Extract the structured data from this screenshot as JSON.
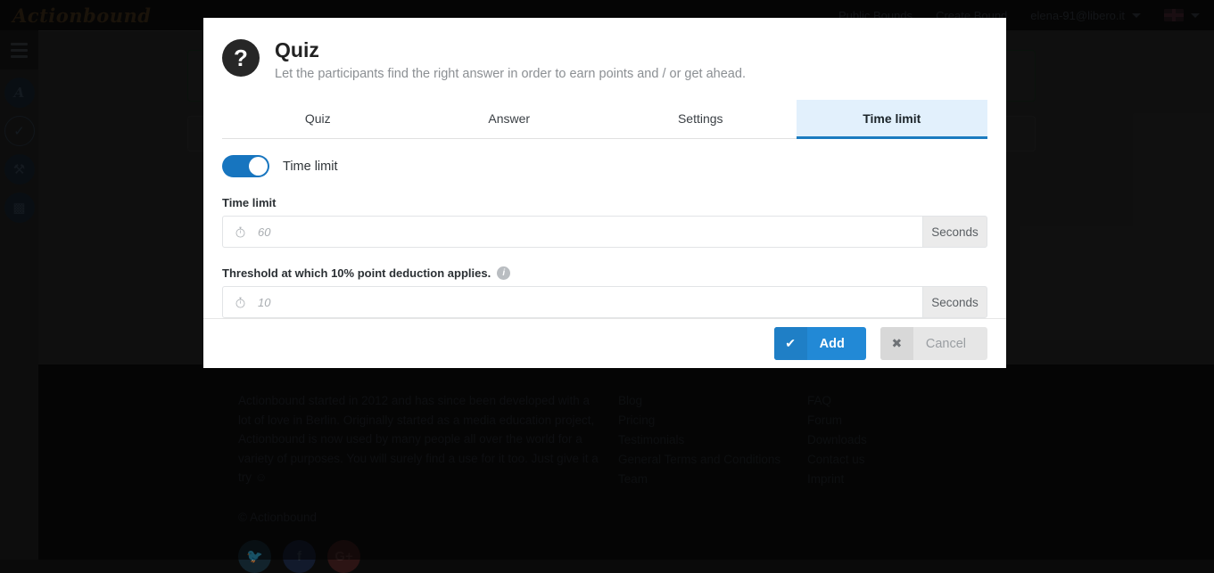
{
  "navbar": {
    "brand": "Actionbound",
    "links": [
      "Public Bounds",
      "Create Bound"
    ],
    "user": "elena-91@libero.it",
    "language_flag": "uk-flag-icon"
  },
  "sidebar": {
    "menu_icon": "hamburger-icon",
    "items": [
      {
        "icon": "actionbound-a-icon"
      },
      {
        "icon": "feather-quill-icon"
      },
      {
        "icon": "wrench-icon"
      },
      {
        "icon": "bar-chart-icon"
      }
    ]
  },
  "modal": {
    "icon": "question-mark-icon",
    "title": "Quiz",
    "subtitle": "Let the participants find the right answer in order to earn points and / or get ahead.",
    "tabs": [
      {
        "label": "Quiz",
        "active": false
      },
      {
        "label": "Answer",
        "active": false
      },
      {
        "label": "Settings",
        "active": false
      },
      {
        "label": "Time limit",
        "active": true
      }
    ],
    "toggle": {
      "label": "Time limit",
      "on": true
    },
    "fields": [
      {
        "label": "Time limit",
        "placeholder": "60",
        "unit": "Seconds",
        "icon": "stopwatch-icon",
        "value": ""
      },
      {
        "label": "Threshold at which 10% point deduction applies.",
        "placeholder": "10",
        "unit": "Seconds",
        "icon": "stopwatch-icon",
        "info_icon": "info-icon",
        "value": ""
      }
    ],
    "buttons": {
      "add": {
        "label": "Add",
        "icon": "check-icon"
      },
      "cancel": {
        "label": "Cancel",
        "icon": "close-icon"
      }
    }
  },
  "footer": {
    "about": "Actionbound started in 2012 and has since been developed with a lot of love in Berlin. Originally started as a media education project, Actionbound is now used by many people all over the world for a variety of purposes. You will surely find a use for it too. Just give it a try ☺",
    "copyright": "© Actionbound",
    "social": [
      {
        "name": "twitter-icon",
        "glyph": "🐦"
      },
      {
        "name": "facebook-icon",
        "glyph": "f"
      },
      {
        "name": "googleplus-icon",
        "glyph": "G+"
      }
    ],
    "column1": [
      "Blog",
      "Pricing",
      "Testimonials",
      "General Terms and Conditions",
      "Team"
    ],
    "column2": [
      "FAQ",
      "Forum",
      "Downloads",
      "Contact us",
      "Imprint"
    ]
  },
  "colors": {
    "accent_blue": "#2289d6",
    "toggle_blue": "#1775bf",
    "active_tab_bg": "#e2f0fc",
    "active_tab_border": "#1c7cc0"
  }
}
